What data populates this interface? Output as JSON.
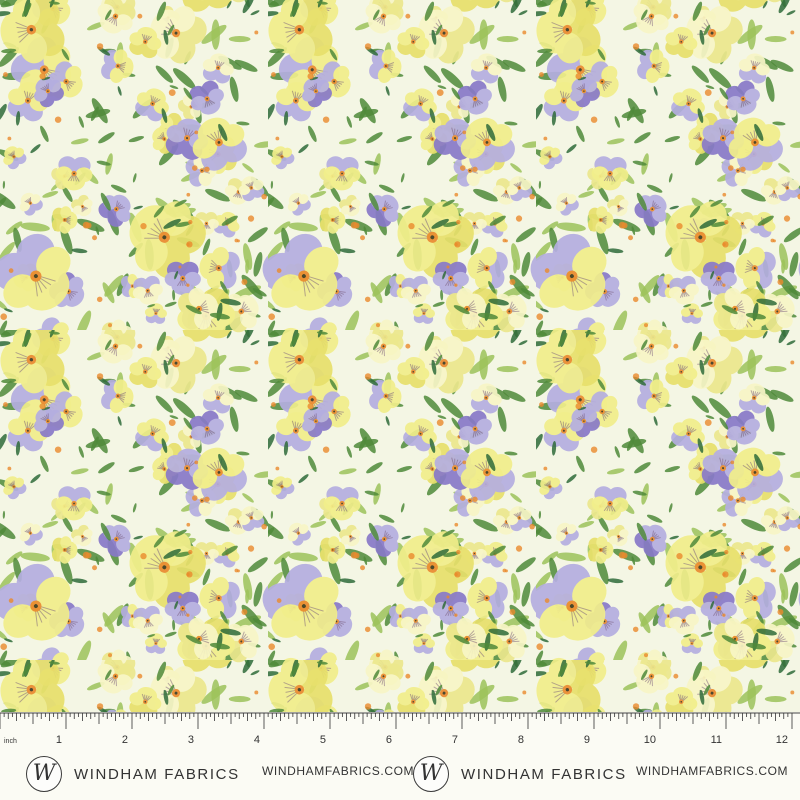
{
  "ruler": {
    "unit": "inch",
    "numbers": [
      "1",
      "2",
      "3",
      "4",
      "5",
      "6",
      "7",
      "8",
      "9",
      "10",
      "11",
      "12"
    ]
  },
  "branding": {
    "logo_letter": "W",
    "name": "WINDHAM FABRICS",
    "url": "WINDHAMFABRICS.COM"
  },
  "colors": {
    "background": "#f4f6e4",
    "yellow_petal": "#f1ee8a",
    "pale_yellow": "#f8f6c6",
    "purple_petal": "#8878c8",
    "lavender": "#b4aee0",
    "orange_center": "#ea8a2c",
    "leaf_green": "#4f8a3a",
    "light_green": "#9cc25a"
  }
}
